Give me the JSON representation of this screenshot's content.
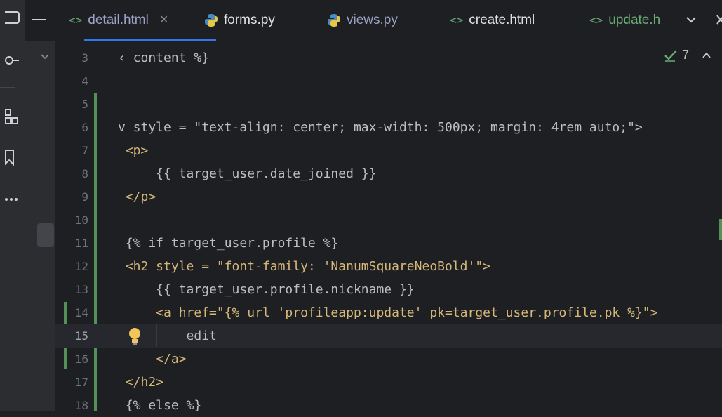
{
  "tabs": [
    {
      "label": "detail.html",
      "icon": "html-icon",
      "active": true
    },
    {
      "label": "forms.py",
      "icon": "python-icon"
    },
    {
      "label": "views.py",
      "icon": "python-icon"
    },
    {
      "label": "create.html",
      "icon": "html-icon"
    },
    {
      "label": "update.h",
      "icon": "html-icon"
    }
  ],
  "tab_close": "×",
  "tab_more": "⌄",
  "inspection": {
    "count": "7"
  },
  "lines": [
    {
      "num": "3",
      "text": "‹ content %}"
    },
    {
      "num": "4",
      "text": ""
    },
    {
      "num": "5",
      "text": ""
    },
    {
      "num": "6",
      "text": "v style = \"text-align: center; max-width: 500px; margin: 4rem auto;\">"
    },
    {
      "num": "7",
      "text": " <p>"
    },
    {
      "num": "8",
      "text": "     {{ target_user.date_joined }}"
    },
    {
      "num": "9",
      "text": " </p>"
    },
    {
      "num": "10",
      "text": ""
    },
    {
      "num": "11",
      "text": " {% if target_user.profile %}"
    },
    {
      "num": "12",
      "text": " <h2 style = \"font-family: 'NanumSquareNeoBold'\">"
    },
    {
      "num": "13",
      "text": "     {{ target_user.profile.nickname }}"
    },
    {
      "num": "14",
      "text": "     <a href=\"{% url 'profileapp:update' pk=target_user.profile.pk %}\">"
    },
    {
      "num": "15",
      "text": "         edit"
    },
    {
      "num": "16",
      "text": "     </a>"
    },
    {
      "num": "17",
      "text": " </h2>"
    },
    {
      "num": "18",
      "text": " {% else %}"
    }
  ],
  "colors": {
    "accent": "#3574f0",
    "added": "#549159",
    "modified": "#375239"
  }
}
